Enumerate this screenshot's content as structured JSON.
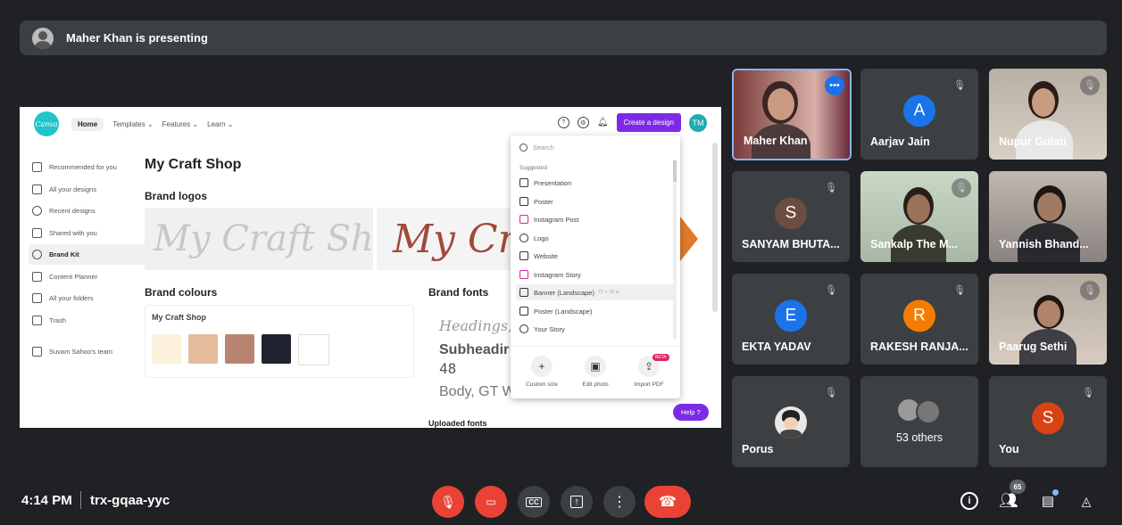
{
  "banner": {
    "text": "Maher Khan is presenting"
  },
  "canva": {
    "logo": "Canva",
    "nav": {
      "home": "Home",
      "templates": "Templates ⌄",
      "features": "Features ⌄",
      "learn": "Learn ⌄"
    },
    "create_label": "Create a design",
    "user_initials": "TM",
    "sidebar": [
      {
        "label": "Recommended for you",
        "icon": "home-icon"
      },
      {
        "label": "All your designs",
        "icon": "grid-icon"
      },
      {
        "label": "Recent designs",
        "icon": "clock-icon"
      },
      {
        "label": "Shared with you",
        "icon": "people-icon"
      },
      {
        "label": "Brand Kit",
        "icon": "brand-icon"
      },
      {
        "label": "Content Planner",
        "icon": "calendar-icon"
      },
      {
        "label": "All your folders",
        "icon": "folder-icon"
      },
      {
        "label": "Trash",
        "icon": "trash-icon"
      },
      {
        "label": "Suvam Sahoo's team",
        "icon": "team-icon"
      }
    ],
    "page_title": "My Craft Shop",
    "brand_logos": "Brand logos",
    "logo_text_a": "My Craft Shop",
    "logo_text_b": "My Craf",
    "brand_colours": "Brand colours",
    "palette_name": "My Craft Shop",
    "colours": [
      "#fbf1dc",
      "#e4bb9c",
      "#b88472",
      "#1f2430",
      "#ffffff"
    ],
    "brand_fonts": "Brand fonts",
    "font_heading": "Headings, Da",
    "font_sub": "Subheadir",
    "font_sub_size": "48",
    "font_body": "Body, GT W",
    "uploaded_fonts": "Uploaded fonts",
    "help": "Help ?",
    "dropdown": {
      "search_placeholder": "Search",
      "suggested": "Suggested",
      "items": [
        {
          "label": "Presentation",
          "icon": "presentation-icon"
        },
        {
          "label": "Poster",
          "icon": "poster-icon"
        },
        {
          "label": "Instagram Post",
          "icon": "instagram-icon"
        },
        {
          "label": "Logo",
          "icon": "logo-icon"
        },
        {
          "label": "Website",
          "icon": "website-icon"
        },
        {
          "label": "Instagram Story",
          "icon": "instagram-icon"
        },
        {
          "label": "Banner (Landscape)",
          "icon": "banner-icon",
          "extra": "72 × 30 in"
        },
        {
          "label": "Poster (Landscape)",
          "icon": "poster-icon"
        },
        {
          "label": "Your Story",
          "icon": "story-icon"
        }
      ],
      "footer": [
        {
          "label": "Custom size",
          "icon": "plus-icon"
        },
        {
          "label": "Edit photo",
          "icon": "edit-photo-icon"
        },
        {
          "label": "Import PDF",
          "icon": "upload-icon",
          "badge": "BETA"
        }
      ]
    }
  },
  "participants": [
    {
      "name": "Maher Khan",
      "type": "photo",
      "active": true
    },
    {
      "name": "Aarjav Jain",
      "initial": "A",
      "color": "#1a73e8",
      "muted": true
    },
    {
      "name": "Nupur Gulati",
      "type": "photo",
      "muted": true
    },
    {
      "name": "SANYAM BHUTA...",
      "initial": "S",
      "color": "#6d4c41",
      "muted": true
    },
    {
      "name": "Sankalp The M...",
      "type": "photo",
      "muted": true
    },
    {
      "name": "Yannish Bhand...",
      "type": "photo"
    },
    {
      "name": "EKTA YADAV",
      "initial": "E",
      "color": "#1a73e8",
      "muted": true
    },
    {
      "name": "RAKESH RANJA...",
      "initial": "R",
      "color": "#f57c00",
      "muted": true
    },
    {
      "name": "Paarug Sethi",
      "type": "photo",
      "muted": true
    },
    {
      "name": "Porus",
      "type": "avatar",
      "muted": true
    },
    {
      "name": "53 others",
      "type": "others"
    },
    {
      "name": "You",
      "initial": "S",
      "color": "#d84315",
      "muted": true
    }
  ],
  "bottom": {
    "time": "4:14 PM",
    "meeting_code": "trx-gqaa-yyc",
    "people_count": "65"
  }
}
